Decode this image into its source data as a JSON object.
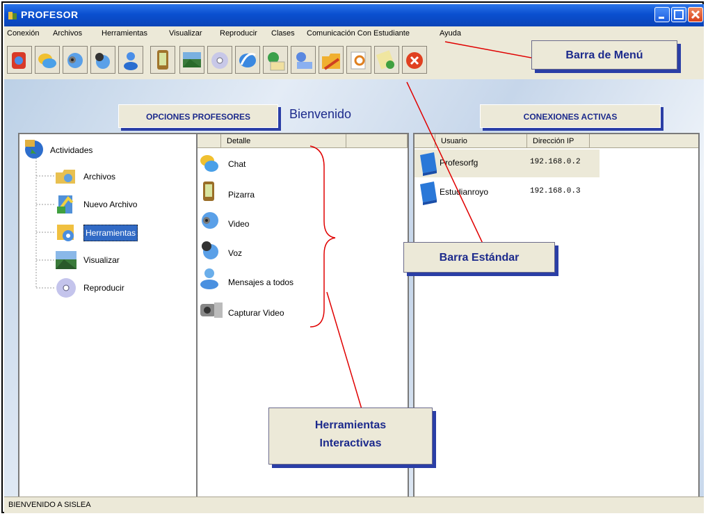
{
  "window": {
    "title": "PROFESOR",
    "min_icon": "minimize-icon",
    "max_icon": "maximize-icon",
    "close_icon": "close-icon"
  },
  "menu": [
    "Conexión",
    "Archivos",
    "Herramientas",
    "Visualizar",
    "Reproducir",
    "Clases",
    "Comunicación Con Estudiante",
    "Ayuda"
  ],
  "toolbar_icons": [
    "connect-icon",
    "chat-icon",
    "video-icon",
    "voice-icon",
    "whiteboard-icon",
    "visualize-icon",
    "play-icon",
    "internet-icon",
    "mail-icon",
    "files-icon",
    "folder-icon",
    "search-icon",
    "notes-icon",
    "close-icon"
  ],
  "headers": {
    "opciones": "OPCIONES PROFESORES",
    "bienvenido": "Bienvenido",
    "conexiones": "CONEXIONES ACTIVAS"
  },
  "tree": {
    "root": "Actividades",
    "items": [
      "Archivos",
      "Nuevo Archivo",
      "Herramientas",
      "Visualizar",
      "Reproducir"
    ],
    "selected": "Herramientas"
  },
  "details": {
    "column": "Detalle",
    "items": [
      "Chat",
      "Pizarra",
      "Video",
      "Voz",
      "Mensajes a todos",
      "Capturar Video"
    ]
  },
  "connections": {
    "columns": [
      "Usuario",
      "Dirección IP"
    ],
    "rows": [
      {
        "user": "Profesorfg",
        "ip": "192.168.0.2"
      },
      {
        "user": "Estudianroyo",
        "ip": "192.168.0.3"
      }
    ]
  },
  "status": "BIENVENIDO A SISLEA",
  "callouts": {
    "menu": "Barra de Menú",
    "standard": "Barra Estándar",
    "tools_line1": "Herramientas",
    "tools_line2": "Interactivas"
  },
  "colors": {
    "accent": "#1c2a8c",
    "callout_shadow": "#2a3ea6",
    "title_bar": "#0a4fd0",
    "pointer": "#e00000"
  }
}
